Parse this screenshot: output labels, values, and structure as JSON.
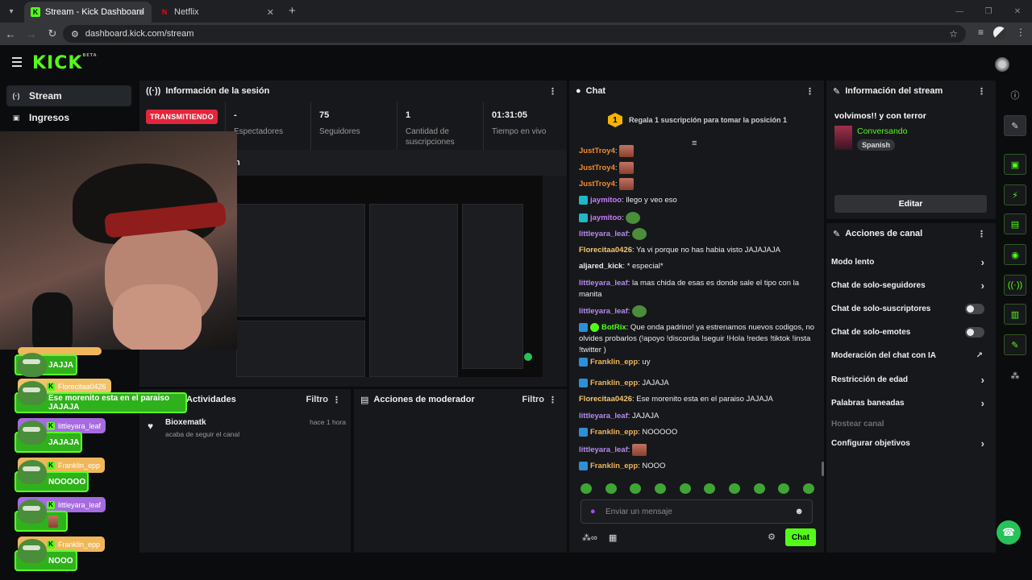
{
  "browser": {
    "tabs": [
      {
        "title": "Stream - Kick Dashboard",
        "active": true
      },
      {
        "title": "Netflix",
        "active": false
      }
    ],
    "url": "dashboard.kick.com/stream"
  },
  "kick": {
    "logo": "KICK",
    "beta": "BETA"
  },
  "sidenav": {
    "items": [
      {
        "label": "Stream",
        "icon": "broadcast-icon"
      },
      {
        "label": "Ingresos",
        "icon": "wallet-icon"
      }
    ]
  },
  "session": {
    "title": "Información de la sesión",
    "live_badge": "TRANSMITIENDO",
    "stats": [
      {
        "value": "-",
        "label": "Espectadores"
      },
      {
        "value": "75",
        "label": "Seguidores"
      },
      {
        "value": "1",
        "label": "Cantidad de suscripciones"
      },
      {
        "value": "01:31:05",
        "label": "Tiempo en vivo"
      }
    ],
    "preview_label": "n"
  },
  "activities": {
    "title": "Actividades",
    "filter": "Filtro",
    "items": [
      {
        "user": "Bioxematk",
        "desc": "acaba de seguir el canal",
        "time": "hace 1 hora"
      }
    ]
  },
  "mod_actions": {
    "title": "Acciones de moderador",
    "filter": "Filtro"
  },
  "chat": {
    "title": "Chat",
    "banner_rank": "1",
    "banner": "Regala 1 suscripción para tomar la posición 1",
    "messages": [
      {
        "user": "JustTroy4",
        "color": "#f08c2e",
        "text": "",
        "emote": "red"
      },
      {
        "user": "JustTroy4",
        "color": "#f08c2e",
        "text": "",
        "emote": "red"
      },
      {
        "user": "JustTroy4",
        "color": "#f08c2e",
        "text": "",
        "emote": "red"
      },
      {
        "user": "jaymitoo",
        "color": "#c77dff",
        "text": "llego y veo eso",
        "badge": "teal"
      },
      {
        "user": "jaymitoo",
        "color": "#c77dff",
        "text": "",
        "badge": "teal",
        "emote": "green"
      },
      {
        "user": "littleyara_leaf",
        "color": "#b58cf0",
        "text": "",
        "emote": "green"
      },
      {
        "user": "Florecitaa0426",
        "color": "#f7c873",
        "text": "Ya vi porque no has habia visto JAJAJAJA"
      },
      {
        "user": "aljared_kick",
        "color": "#eaeaea",
        "text": "* especial*"
      },
      {
        "user": "littleyara_leaf",
        "color": "#b58cf0",
        "text": "la mas chida de esas es donde sale el tipo con la manita"
      },
      {
        "user": "littleyara_leaf",
        "color": "#b58cf0",
        "text": "",
        "emote": "green"
      },
      {
        "user": "BotRix",
        "color": "#53fc18",
        "text": "Que onda padrino! ya estrenamos nuevos codigos, no olvides probarlos (!apoyo !discordia !seguir !Hola !redes !tiktok !insta !twitter )",
        "badge": "blue",
        "badge2": "lime"
      },
      {
        "user": "Franklin_epp",
        "color": "#f0b75a",
        "text": "uy",
        "badge": "blue"
      },
      {
        "user": "Franklin_epp",
        "color": "#f0b75a",
        "text": "JAJAJA",
        "badge": "blue"
      },
      {
        "user": "Florecitaa0426",
        "color": "#f7c873",
        "text": "Ese morenito esta en el paraiso JAJAJA"
      },
      {
        "user": "littleyara_leaf",
        "color": "#b58cf0",
        "text": "JAJAJA"
      },
      {
        "user": "Franklin_epp",
        "color": "#f0b75a",
        "text": "NOOOOO",
        "badge": "blue"
      },
      {
        "user": "littleyara_leaf",
        "color": "#b58cf0",
        "text": "",
        "emote": "red"
      },
      {
        "user": "Franklin_epp",
        "color": "#f0b75a",
        "text": "NOOO",
        "badge": "blue"
      }
    ],
    "input_placeholder": "Enviar un mensaje",
    "send_label": "Chat"
  },
  "stream_info": {
    "title": "Información del stream",
    "stream_title": "volvimos!! y con terror",
    "category": "Conversando",
    "language": "Spanish",
    "edit_label": "Editar"
  },
  "channel_actions": {
    "title": "Acciones de canal",
    "items": [
      {
        "label": "Modo lento",
        "control": "chevron"
      },
      {
        "label": "Chat de solo-seguidores",
        "control": "chevron"
      },
      {
        "label": "Chat de solo-suscriptores",
        "control": "toggle"
      },
      {
        "label": "Chat de solo-emotes",
        "control": "toggle"
      },
      {
        "label": "Moderación del chat con IA",
        "control": "external"
      },
      {
        "label": "Restricción de edad",
        "control": "chevron"
      },
      {
        "label": "Palabras baneadas",
        "control": "chevron"
      },
      {
        "label": "Hostear canal",
        "control": "disabled"
      },
      {
        "label": "Configurar objetivos",
        "control": "chevron"
      }
    ]
  },
  "overlay": {
    "entries": [
      {
        "name": "",
        "msg": "JAJJA",
        "name_color": "#f0b75a"
      },
      {
        "name": "Florecitaa0426",
        "msg": "Ese morenito esta en el paraiso JAJAJA",
        "name_color": "#f0c26a"
      },
      {
        "name": "littleyara_leaf",
        "msg": "JAJAJA",
        "name_color": "#a66be0"
      },
      {
        "name": "Franklin_epp",
        "msg": "NOOOOO",
        "name_color": "#f0b75a"
      },
      {
        "name": "littleyara_leaf",
        "msg": "",
        "name_color": "#a66be0"
      },
      {
        "name": "Franklin_epp",
        "msg": "NOOO",
        "name_color": "#f0b75a"
      }
    ]
  }
}
